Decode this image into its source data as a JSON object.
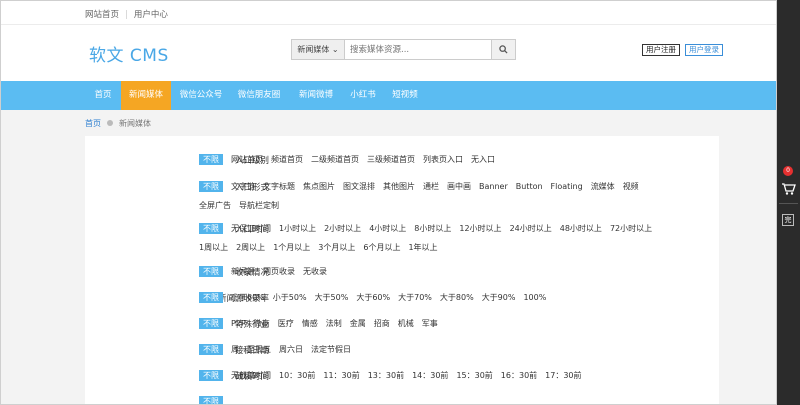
{
  "topbar": {
    "links": [
      "网站首页",
      "用户中心"
    ]
  },
  "header": {
    "logo": "软文 CMS",
    "search": {
      "category": "新闻媒体 ⌄",
      "placeholder": "搜索媒体资源..."
    },
    "register": "用户注册",
    "login": "用户登录"
  },
  "nav": {
    "items": [
      "首页",
      "新闻媒体",
      "微信公众号",
      "微信朋友圈",
      "新闻微博",
      "小红书",
      "短视频"
    ],
    "active_index": 1,
    "colors": {
      "bar": "#5bbcf2",
      "active": "#f5a623"
    }
  },
  "breadcrumb": {
    "home": "首页",
    "current": "新闻媒体"
  },
  "filters": [
    {
      "label": "入口级别",
      "options": [
        "不限",
        "网站首页",
        "频道首页",
        "二级频道首页",
        "三级频道首页",
        "列表页入口",
        "无入口"
      ]
    },
    {
      "label": "入口形式",
      "options": [
        "不限",
        "文字链",
        "文字标题",
        "焦点图片",
        "图文混排",
        "其他图片",
        "通栏",
        "画中画",
        "Banner",
        "Button",
        "Floating",
        "流媒体",
        "视频",
        "全屏广告",
        "导航栏定制"
      ]
    },
    {
      "label": "入口时间",
      "options": [
        "不限",
        "无保证时间",
        "1小时以上",
        "2小时以上",
        "4小时以上",
        "8小时以上",
        "12小时以上",
        "24小时以上",
        "48小时以上",
        "72小时以上",
        "1周以上",
        "2周以上",
        "1个月以上",
        "3个月以上",
        "6个月以上",
        "1年以上"
      ]
    },
    {
      "label": "收录情况",
      "options": [
        "不限",
        "新闻源",
        "网页收录",
        "无收录"
      ]
    },
    {
      "label": "新闻源收录率",
      "options": [
        "不限",
        "小于60%",
        "小于50%",
        "大于50%",
        "大于60%",
        "大于70%",
        "大于80%",
        "大于90%",
        "100%"
      ]
    },
    {
      "label": "特殊行业",
      "options": [
        "不限",
        "P2P",
        "微商",
        "医疗",
        "情感",
        "法制",
        "金属",
        "招商",
        "机械",
        "军事"
      ]
    },
    {
      "label": "接稿日期",
      "options": [
        "不限",
        "周一至周五",
        "周六日",
        "法定节假日"
      ]
    },
    {
      "label": "截稿时间",
      "options": [
        "不限",
        "无截稿时间",
        "10：30前",
        "11：30前",
        "13：30前",
        "14：30前",
        "15：30前",
        "16：30前",
        "17：30前"
      ]
    },
    {
      "label": "",
      "options": [
        "不限"
      ]
    }
  ],
  "sidebar": {
    "cart_count": "0",
    "tool_label": "完"
  }
}
